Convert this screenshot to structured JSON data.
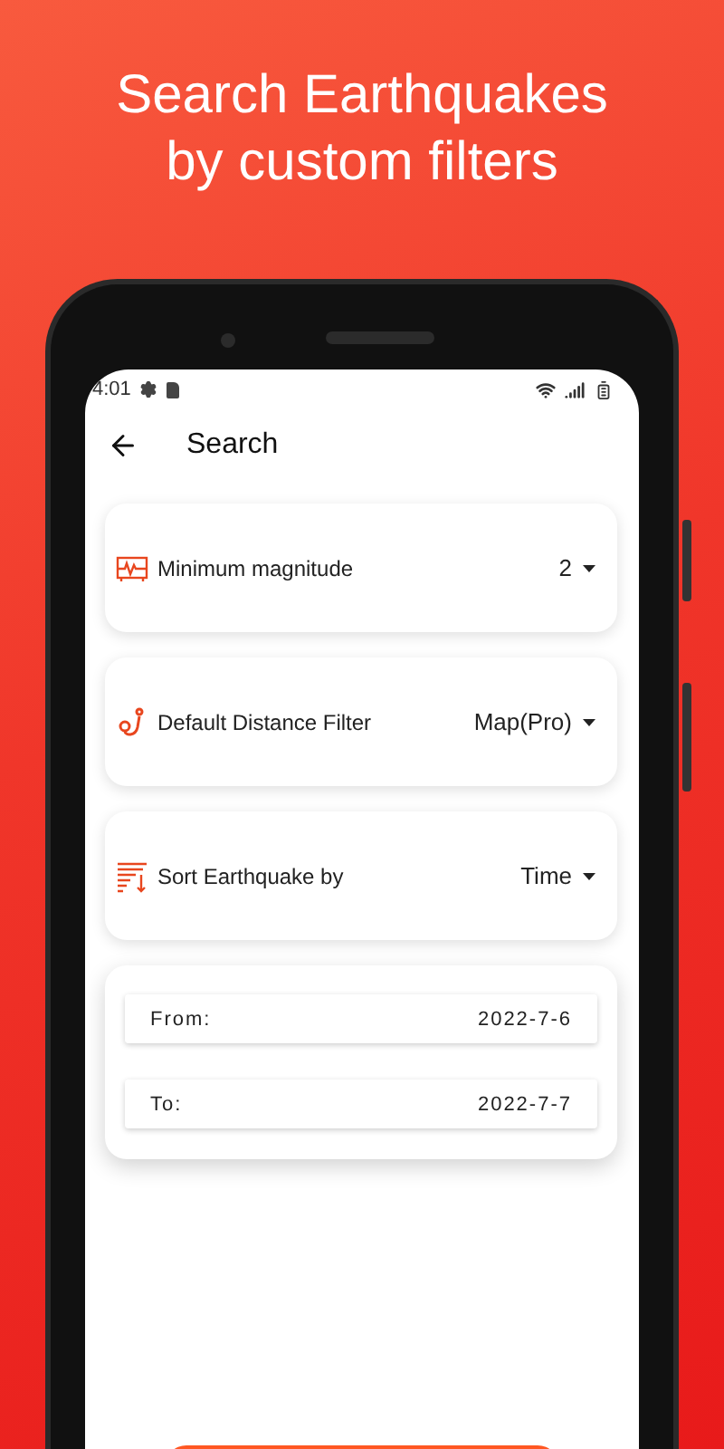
{
  "headline": "Search Earthquakes by custom filters",
  "status_bar": {
    "time": "4:01"
  },
  "app_bar": {
    "title": "Search"
  },
  "filters": [
    {
      "label": "Minimum magnitude",
      "value": "2"
    },
    {
      "label": "Default Distance Filter",
      "value": "Map(Pro)"
    },
    {
      "label": "Sort Earthquake by",
      "value": "Time"
    }
  ],
  "date_range": [
    {
      "label": "From:",
      "value": "2022-7-6"
    },
    {
      "label": "To:",
      "value": "2022-7-7"
    }
  ]
}
